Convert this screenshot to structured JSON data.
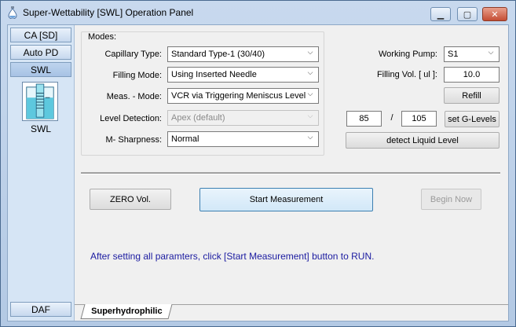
{
  "window": {
    "title": "Super-Wettability [SWL] Operation Panel"
  },
  "nav": {
    "items": [
      "CA [SD]",
      "Auto PD",
      "SWL"
    ],
    "image_label": "SWL",
    "bottom_item": "DAF"
  },
  "modes": {
    "group_title": "Modes:",
    "capillary_type": {
      "label": "Capillary Type:",
      "value": "Standard Type-1 (30/40)"
    },
    "filling_mode": {
      "label": "Filling Mode:",
      "value": "Using Inserted Needle"
    },
    "meas_mode": {
      "label": "Meas. - Mode:",
      "value": "VCR via Triggering Meniscus Level"
    },
    "level_detection": {
      "label": "Level Detection:",
      "value": "Apex (default)"
    },
    "m_sharpness": {
      "label": "M- Sharpness:",
      "value": "Normal"
    }
  },
  "pump": {
    "working_pump_label": "Working Pump:",
    "working_pump_value": "S1",
    "filling_vol_label": "Filling Vol. [ ul ]:",
    "filling_vol_value": "10.0",
    "refill_label": "Refill",
    "level_low": "85",
    "level_sep": "/",
    "level_high": "105",
    "set_g_levels_label": "set G-Levels",
    "detect_label": "detect Liquid Level"
  },
  "actions": {
    "zero_vol": "ZERO Vol.",
    "start_measurement": "Start Measurement",
    "begin_now": "Begin Now"
  },
  "message": "After setting all paramters, click [Start Measurement] button to RUN.",
  "tab": "Superhydrophilic"
}
